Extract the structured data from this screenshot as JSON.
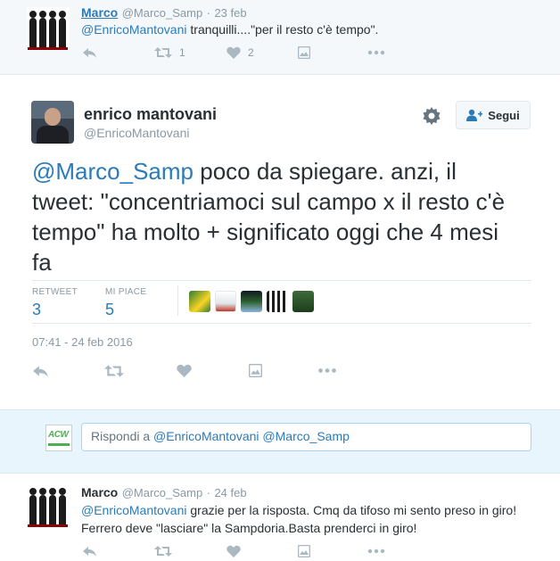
{
  "top_tweet": {
    "name": "Marco",
    "handle": "@Marco_Samp",
    "sep": "·",
    "date": "23 feb",
    "mention": "@EnricoMantovani",
    "text": " tranquilli....\"per il resto  c'è tempo\".",
    "retweet_count": "1",
    "like_count": "2"
  },
  "main_tweet": {
    "name": "enrico mantovani",
    "handle": "@EnricoMantovani",
    "follow_label": "Segui",
    "mention": "@Marco_Samp",
    "text_line1": " poco da spiegare. anzi, il",
    "text_line2": "tweet: \"concentriamoci sul campo x il resto c'è",
    "text_line3": "tempo\" ha molto + significato oggi che 4 mesi",
    "text_line4": "fa",
    "retweet_label": "RETWEET",
    "retweet_value": "3",
    "likes_label": "MI PIACE",
    "likes_value": "5",
    "timestamp": "07:41 - 24 feb 2016"
  },
  "reply_box": {
    "prefix": "Rispondi a ",
    "mentions": "@EnricoMantovani @Marco_Samp",
    "logo_text": "ACW"
  },
  "bottom_tweet": {
    "name": "Marco",
    "handle": "@Marco_Samp",
    "sep": "·",
    "date": "24 feb",
    "mention": "@EnricoMantovani",
    "text_line1": " grazie per la risposta. Cmq da tifoso mi sento preso in giro!",
    "text_line2": "Ferrero deve \"lasciare\" la Sampdoria.Basta prenderci in giro!"
  },
  "icons": [
    "reply-icon",
    "retweet-icon",
    "like-icon",
    "image-icon",
    "more-icon",
    "gear-icon",
    "add-user-icon"
  ],
  "colors": {
    "link": "#2b7bb9",
    "muted": "#8899a6",
    "icon": "#aab8c2",
    "reply_bg": "#e8f5fd",
    "header_bg": "#f5f8fa"
  }
}
